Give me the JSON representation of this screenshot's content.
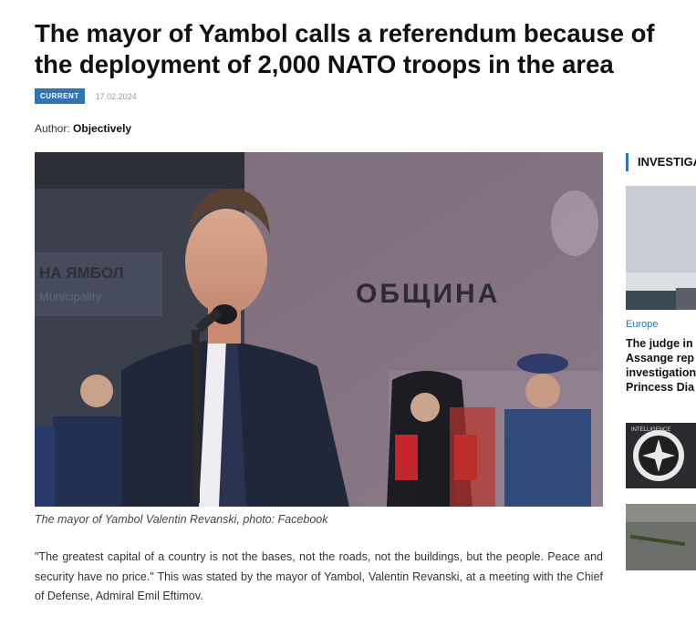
{
  "article": {
    "title": "The mayor of Yambol calls a referendum because of the deployment of 2,000 NATO troops in the area",
    "category_badge": "CURRENT",
    "date": "17.02.2024",
    "author_label": "Author:",
    "author_name": "Objectively",
    "image_caption": "The mayor of Yambol Valentin Revanski, photo: Facebook",
    "body_paragraph": "\"The greatest capital of a country is not the bases, not the roads, not the buildings, but the people. Peace and security have no price.\" This was stated by the mayor of Yambol, Valentin Revanski, at a meeting with the Chief of Defense, Admiral Emil Eftimov.",
    "photo_sign_text": "ОБЩИНА",
    "photo_left_sign_lines": [
      "НА ЯМБОЛ",
      "Municipality"
    ]
  },
  "sidebar": {
    "heading": "INVESTIGA",
    "items": [
      {
        "category": "Europe",
        "title_lines": [
          "The judge in",
          "Assange rep",
          "investigation",
          "Princess Dia"
        ]
      },
      {
        "thumb_text": "INTELLIGENCE"
      },
      {}
    ]
  },
  "colors": {
    "accent": "#2f74b5",
    "title_text": "#111111",
    "muted_text": "#9a9a9a"
  }
}
